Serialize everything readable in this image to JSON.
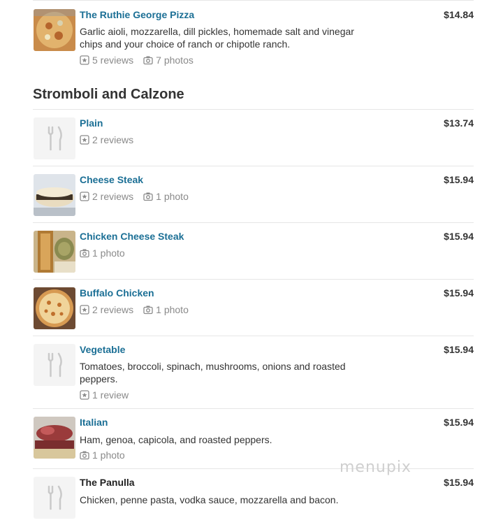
{
  "section": {
    "title": "Stromboli and Calzone"
  },
  "items": [
    {
      "name": "The Ruthie George Pizza",
      "price": "$14.84",
      "description": "Garlic aioli, mozzarella, dill pickles, homemade salt and vinegar chips and your choice of ranch or chipotle ranch.",
      "reviews": "5 reviews",
      "photos": "7 photos"
    },
    {
      "name": "Plain",
      "price": "$13.74",
      "reviews": "2 reviews"
    },
    {
      "name": "Cheese Steak",
      "price": "$15.94",
      "reviews": "2 reviews",
      "photos": "1 photo"
    },
    {
      "name": "Chicken Cheese Steak",
      "price": "$15.94",
      "photos": "1 photo"
    },
    {
      "name": "Buffalo Chicken",
      "price": "$15.94",
      "reviews": "2 reviews",
      "photos": "1 photo"
    },
    {
      "name": "Vegetable",
      "price": "$15.94",
      "description": "Tomatoes, broccoli, spinach, mushrooms, onions and roasted peppers.",
      "reviews": "1 review"
    },
    {
      "name": "Italian",
      "price": "$15.94",
      "description": "Ham, genoa, capicola, and roasted peppers.",
      "photos": "1 photo"
    },
    {
      "name": "The Panulla",
      "price": "$15.94",
      "description": "Chicken, penne pasta, vodka sauce, mozzarella and bacon."
    }
  ],
  "watermark": "menupix",
  "colors": {
    "link": "#1b6f95",
    "meta": "#8a8a8a",
    "divider": "#e6e6e6",
    "placeholder": "#f4f4f4"
  },
  "icons": {
    "review": "star-box-icon",
    "photo": "camera-icon",
    "placeholder": "fork-knife-icon"
  }
}
